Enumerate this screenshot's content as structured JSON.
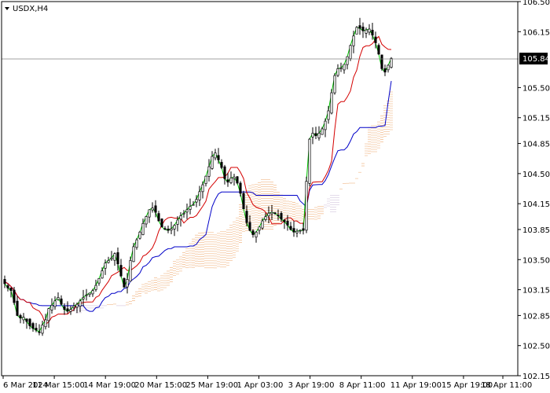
{
  "symbol_label": "USDX,H4",
  "current_price_label": "105.84",
  "colors": {
    "background": "#ffffff",
    "tenkan": "#d40000",
    "kijun": "#0000c8",
    "chikou": "#00c800",
    "cloud_a": "#e8893a",
    "cloud_b": "#b9a0c8",
    "candle": "#000000",
    "price_line": "#808080"
  },
  "chart_data": {
    "type": "candlestick",
    "indicator": "Ichimoku Kinko Hyo",
    "ylim": [
      102.15,
      106.5
    ],
    "y_ticks": [
      "106.50",
      "106.15",
      "105.84",
      "105.50",
      "105.15",
      "104.85",
      "104.50",
      "104.15",
      "103.85",
      "103.50",
      "103.15",
      "102.85",
      "102.50",
      "102.15"
    ],
    "x_ticks": [
      "6 Mar 2024",
      "11 Mar 15:00",
      "14 Mar 19:00",
      "20 Mar 15:00",
      "25 Mar 19:00",
      "1 Apr 03:00",
      "3 Apr 19:00",
      "8 Apr 11:00",
      "11 Apr 19:00",
      "15 Apr 19:00",
      "18 Apr 11:00"
    ],
    "current_price": 105.84,
    "close_series": [
      103.22,
      103.17,
      103.14,
      103.0,
      102.85,
      102.82,
      102.83,
      102.78,
      102.73,
      102.7,
      102.68,
      102.66,
      102.74,
      102.8,
      102.93,
      102.97,
      103.02,
      103.06,
      102.98,
      102.92,
      102.9,
      102.92,
      102.96,
      102.98,
      103.02,
      103.06,
      103.09,
      103.11,
      103.14,
      103.2,
      103.28,
      103.37,
      103.46,
      103.49,
      103.52,
      103.57,
      103.45,
      103.31,
      103.18,
      103.27,
      103.49,
      103.65,
      103.73,
      103.82,
      103.92,
      104.0,
      104.08,
      104.1,
      104.05,
      103.95,
      103.88,
      103.85,
      103.84,
      103.86,
      103.9,
      103.96,
      104.01,
      104.04,
      104.08,
      104.12,
      104.14,
      104.2,
      104.29,
      104.37,
      104.47,
      104.58,
      104.7,
      104.74,
      104.66,
      104.57,
      104.44,
      104.4,
      104.45,
      104.46,
      104.39,
      104.27,
      104.09,
      103.93,
      103.84,
      103.79,
      103.82,
      103.88,
      103.95,
      104.0,
      104.04,
      104.05,
      104.04,
      104.01,
      103.97,
      103.94,
      103.9,
      103.85,
      103.82,
      103.83,
      103.84,
      103.84,
      104.41,
      104.9,
      104.97,
      104.94,
      104.97,
      105.02,
      105.11,
      105.23,
      105.44,
      105.64,
      105.72,
      105.73,
      105.77,
      105.86,
      105.99,
      106.1,
      106.2,
      106.19,
      106.16,
      106.17,
      106.18,
      106.11,
      106.02,
      105.89,
      105.72,
      105.68,
      105.76,
      105.84
    ],
    "x_range_count": 122
  }
}
